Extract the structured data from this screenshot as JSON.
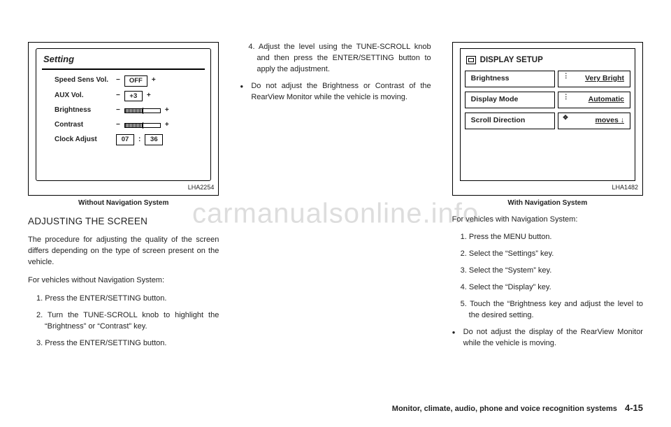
{
  "watermark": "carmanualsonline.info",
  "footer": {
    "section": "Monitor, climate, audio, phone and voice recognition systems",
    "page": "4-15"
  },
  "col1": {
    "figure": {
      "label": "LHA2254",
      "caption": "Without Navigation System",
      "panel_title": "Setting",
      "rows": {
        "speed": {
          "label": "Speed Sens Vol.",
          "minus": "−",
          "value": "OFF",
          "plus": "+"
        },
        "aux": {
          "label": "AUX Vol.",
          "minus": "−",
          "value": "+3",
          "plus": "+"
        },
        "bright": {
          "label": "Brightness",
          "minus": "−",
          "plus": "+"
        },
        "contrast": {
          "label": "Contrast",
          "minus": "−",
          "plus": "+"
        },
        "clock": {
          "label": "Clock Adjust",
          "hh": "07",
          "sep": ":",
          "mm": "36"
        }
      }
    },
    "heading": "ADJUSTING THE SCREEN",
    "p1": "The procedure for adjusting the quality of the screen differs depending on the type of screen present on the vehicle.",
    "p2": "For vehicles without Navigation System:",
    "steps": {
      "s1": "1.  Press the ENTER/SETTING button.",
      "s2": "2.  Turn the TUNE-SCROLL knob to highlight the “Brightness” or “Contrast” key.",
      "s3": "3.  Press the ENTER/SETTING button."
    }
  },
  "col2": {
    "steps": {
      "s4": "4.  Adjust the level using the TUNE-SCROLL knob and then press the ENTER/SETTING button to apply the adjustment."
    },
    "bullet": {
      "b1": "Do not adjust the Brightness or Contrast of the RearView Monitor while the vehicle is moving."
    }
  },
  "col3": {
    "figure": {
      "label": "LHA1482",
      "caption": "With Navigation System",
      "panel_title": "DISPLAY SETUP",
      "rows": {
        "r1": {
          "l": "Brightness",
          "r": "Very Bright",
          "dots": "⋮"
        },
        "r2": {
          "l": "Display Mode",
          "r": "Automatic",
          "dots": "⋮"
        },
        "r3": {
          "l": "Scroll Direction",
          "r": "moves  ↓",
          "icon": "✥"
        }
      }
    },
    "p1": "For vehicles with Navigation System:",
    "steps": {
      "s1": "1.  Press the MENU button.",
      "s2": "2.  Select the “Settings” key.",
      "s3": "3.  Select the “System” key.",
      "s4": "4.  Select the “Display” key.",
      "s5": "5.  Touch the “Brightness key and adjust the level to the desired setting."
    },
    "bullet": {
      "b1": "Do not adjust the display of the RearView Monitor while the vehicle is moving."
    }
  }
}
